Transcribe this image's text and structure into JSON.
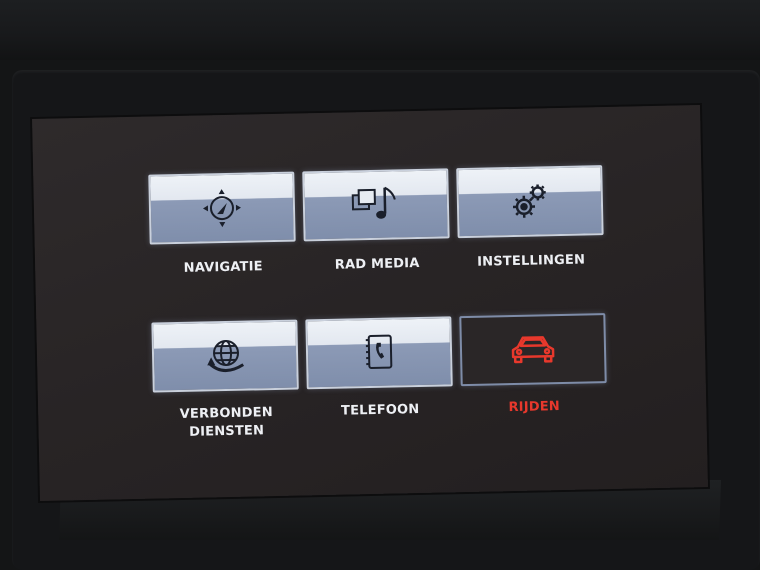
{
  "menu": {
    "items": [
      {
        "label": "NAVIGATIE",
        "icon": "navigation-compass-icon"
      },
      {
        "label": "RAD MEDIA",
        "icon": "media-music-icon"
      },
      {
        "label": "INSTELLINGEN",
        "icon": "settings-gears-icon"
      },
      {
        "label_lines": [
          "VERBONDEN",
          "DIENSTEN"
        ],
        "icon": "connected-globe-icon"
      },
      {
        "label": "TELEFOON",
        "icon": "phone-book-icon"
      },
      {
        "label": "RIJDEN",
        "icon": "car-icon",
        "selected": true
      }
    ]
  },
  "colors": {
    "selected_label": "#e8382c",
    "tile_border": "#c9d0dc",
    "screen_bg": "#2a2627"
  }
}
